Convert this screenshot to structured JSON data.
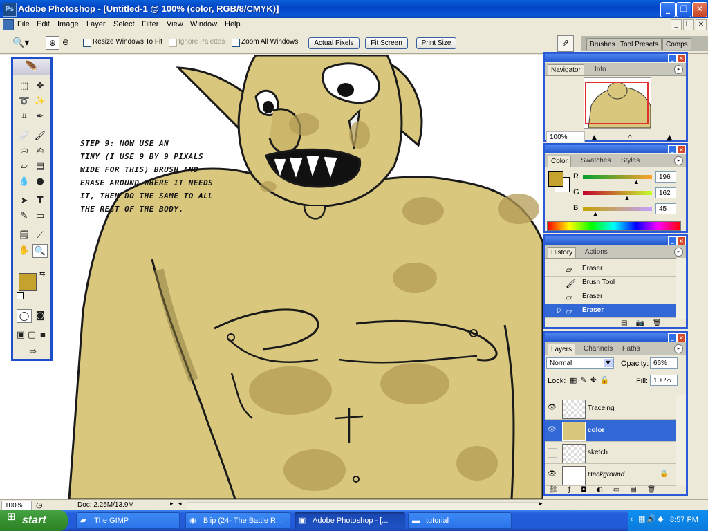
{
  "window": {
    "title": "Adobe Photoshop - [Untitled-1 @ 100% (color, RGB/8/CMYK)]",
    "controls": [
      "_",
      "❐",
      "✕"
    ]
  },
  "menu": {
    "items": [
      "File",
      "Edit",
      "Image",
      "Layer",
      "Select",
      "Filter",
      "View",
      "Window",
      "Help"
    ],
    "doc_controls": [
      "_",
      "❐",
      "✕"
    ]
  },
  "options": {
    "resize_windows": "Resize Windows To Fit",
    "ignore_palettes": "Ignore Palettes",
    "zoom_all": "Zoom All Windows",
    "actual_pixels": "Actual Pixels",
    "fit_screen": "Fit Screen",
    "print_size": "Print Size"
  },
  "palette_well": {
    "tabs": [
      "Brushes",
      "Tool Presets",
      "Comps"
    ]
  },
  "canvas": {
    "tutorial_lines": [
      "STEP 9: NOW USE AN",
      "TINY (I USE 9 BY 9 PIXALS",
      "WIDE FOR THIS) BRUSH AND",
      "ERASE AROUND WHERE IT NEEDS",
      "IT, THEN DO THE SAME TO ALL",
      "THE REST OF THE BODY."
    ],
    "skin_color": "#d9c77e",
    "shade_color": "#b39c55"
  },
  "toolbox": {
    "foreground_color": "#c4a22d",
    "background_color": "#ffffff"
  },
  "navigator": {
    "tabs": [
      "Navigator",
      "Info"
    ],
    "zoom": "100%"
  },
  "color_panel": {
    "tabs": [
      "Color",
      "Swatches",
      "Styles"
    ],
    "channels": [
      {
        "name": "R",
        "value": "196",
        "fraction": 0.769
      },
      {
        "name": "G",
        "value": "162",
        "fraction": 0.635
      },
      {
        "name": "B",
        "value": "45",
        "fraction": 0.176
      }
    ],
    "current_color": "#c4a22d"
  },
  "history": {
    "tabs": [
      "History",
      "Actions"
    ],
    "items": [
      "Eraser",
      "Brush Tool",
      "Eraser",
      "Eraser"
    ],
    "selected_index": 3
  },
  "layers": {
    "tabs": [
      "Layers",
      "Channels",
      "Paths"
    ],
    "blend_mode": "Normal",
    "opacity_label": "Opacity:",
    "opacity": "66%",
    "lock_label": "Lock:",
    "fill_label": "Fill:",
    "fill": "100%",
    "items": [
      {
        "name": "Traceing",
        "visible": true,
        "selected": false
      },
      {
        "name": "color",
        "visible": true,
        "selected": true
      },
      {
        "name": "sketch",
        "visible": false,
        "selected": false
      },
      {
        "name": "Background",
        "visible": true,
        "selected": false,
        "locked": true
      }
    ]
  },
  "status": {
    "zoom": "100%",
    "doc": "Doc: 2.25M/13.9M"
  },
  "taskbar": {
    "start": "start",
    "items": [
      {
        "label": "The GIMP",
        "active": false
      },
      {
        "label": "Blip (24- The Battle R...",
        "active": false
      },
      {
        "label": "Adobe Photoshop - [...",
        "active": true
      },
      {
        "label": "tutorial",
        "active": false
      }
    ],
    "clock": "8:57 PM"
  }
}
